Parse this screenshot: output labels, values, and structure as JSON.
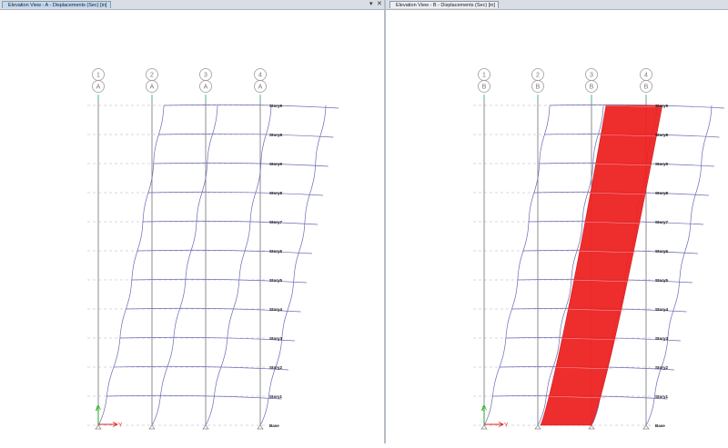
{
  "left_panel": {
    "tab_title": "Elevation View - A - Displacements (Sec) [in]",
    "pin_glyph": "▾",
    "close_glyph": "✕",
    "elevation_letter": "A",
    "gridlines": [
      "1",
      "2",
      "3",
      "4"
    ]
  },
  "right_panel": {
    "tab_title": "Elevation View - B - Displacements (Sec) [in]",
    "elevation_letter": "B",
    "gridlines": [
      "1",
      "2",
      "3",
      "4"
    ]
  },
  "story_labels": [
    "Story9",
    "Story8",
    "Story9",
    "Story8",
    "Story7",
    "Story6",
    "Story5",
    "Story4",
    "Story3",
    "Story2",
    "Story1",
    "Base"
  ],
  "axis": {
    "vertical": "Z",
    "horizontal": "Y"
  },
  "colors": {
    "frame": "#8c8c8c",
    "deformed": "#6a6ab4",
    "highlight": "#ee2222",
    "story_line": "#aab0d0",
    "axis_z": "#22aa22",
    "axis_y": "#dd2222"
  }
}
